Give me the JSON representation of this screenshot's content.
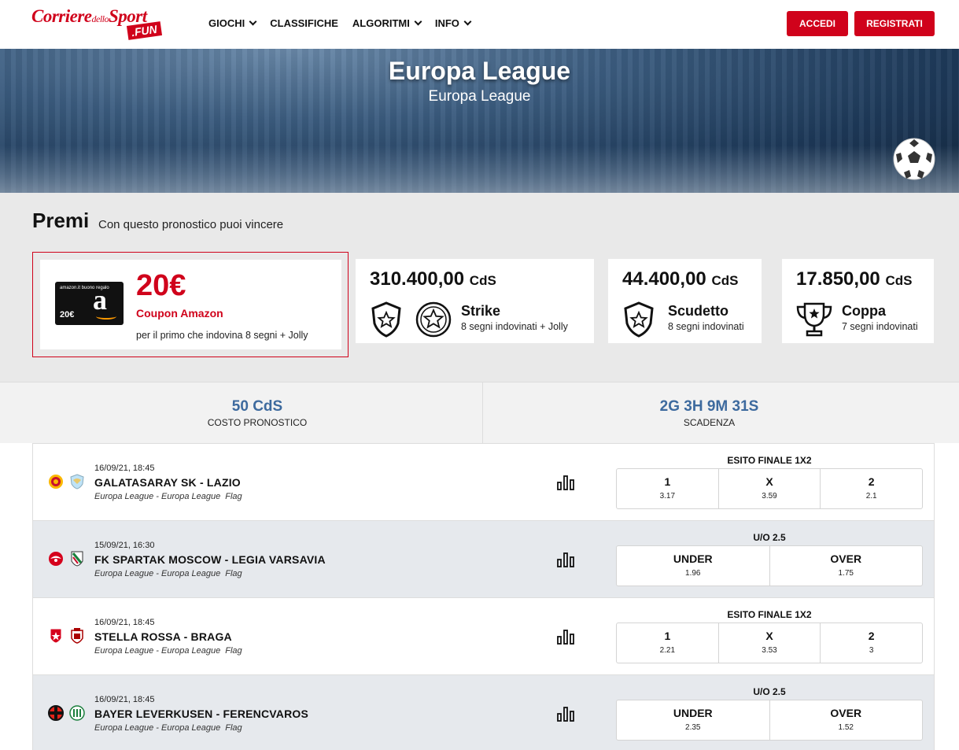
{
  "header": {
    "logo_main": "Corriere",
    "logo_small": "dello",
    "logo_main2": "Sport",
    "logo_badge": ".FUN",
    "nav": [
      {
        "label": "GIOCHI",
        "dropdown": true
      },
      {
        "label": "CLASSIFICHE",
        "dropdown": false
      },
      {
        "label": "ALGORITMI",
        "dropdown": true
      },
      {
        "label": "INFO",
        "dropdown": true
      }
    ],
    "login_label": "ACCEDI",
    "register_label": "REGISTRATI"
  },
  "hero": {
    "title": "Europa League",
    "subtitle": "Europa League"
  },
  "prizes": {
    "title": "Premi",
    "subtitle": "Con questo pronostico puoi vincere",
    "main": {
      "gift_text": "amazon.it buono regalo",
      "gift_value": "20€",
      "gift_letter": "a",
      "value": "20€",
      "name": "Coupon Amazon",
      "desc": "per il primo che indovina 8 segni + Jolly"
    },
    "cards": [
      {
        "amount": "310.400,00",
        "unit": "CdS",
        "name": "Strike",
        "desc": "8 segni indovinati + Jolly",
        "icon": "shield-star-icon"
      },
      {
        "amount": "44.400,00",
        "unit": "CdS",
        "name": "Scudetto",
        "desc": "8 segni indovinati",
        "icon": "shield-star-icon"
      },
      {
        "amount": "17.850,00",
        "unit": "CdS",
        "name": "Coppa",
        "desc": "7 segni indovinati",
        "icon": "trophy-icon"
      }
    ]
  },
  "info": {
    "cost_value": "50 CdS",
    "cost_label": "COSTO PRONOSTICO",
    "deadline_value": "2G 3H 9M 31S",
    "deadline_label": "SCADENZA"
  },
  "matches": [
    {
      "date": "16/09/21, 18:45",
      "teams": "GALATASARAY SK - LAZIO",
      "competition": "Europa League - Europa League",
      "flag": "Flag",
      "market": "ESITO FINALE 1X2",
      "odds": [
        {
          "label": "1",
          "value": "3.17"
        },
        {
          "label": "X",
          "value": "3.59"
        },
        {
          "label": "2",
          "value": "2.1"
        }
      ]
    },
    {
      "date": "15/09/21, 16:30",
      "teams": "FK SPARTAK MOSCOW - LEGIA VARSAVIA",
      "competition": "Europa League - Europa League",
      "flag": "Flag",
      "market": "U/O 2.5",
      "odds": [
        {
          "label": "UNDER",
          "value": "1.96"
        },
        {
          "label": "OVER",
          "value": "1.75"
        }
      ]
    },
    {
      "date": "16/09/21, 18:45",
      "teams": "STELLA ROSSA - BRAGA",
      "competition": "Europa League - Europa League",
      "flag": "Flag",
      "market": "ESITO FINALE 1X2",
      "odds": [
        {
          "label": "1",
          "value": "2.21"
        },
        {
          "label": "X",
          "value": "3.53"
        },
        {
          "label": "2",
          "value": "3"
        }
      ]
    },
    {
      "date": "16/09/21, 18:45",
      "teams": "BAYER LEVERKUSEN - FERENCVAROS",
      "competition": "Europa League - Europa League",
      "flag": "Flag",
      "market": "U/O 2.5",
      "odds": [
        {
          "label": "UNDER",
          "value": "2.35"
        },
        {
          "label": "OVER",
          "value": "1.52"
        }
      ]
    }
  ],
  "colors": {
    "brand_red": "#d0021b",
    "accent_blue": "#3d6a9e"
  }
}
